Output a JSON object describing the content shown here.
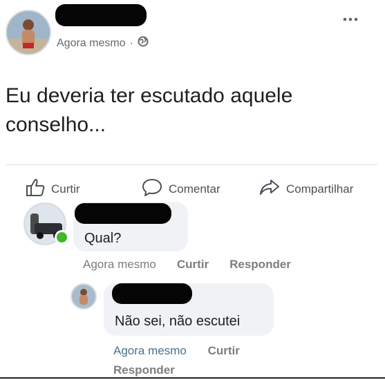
{
  "post": {
    "timestamp": "Agora mesmo",
    "separator": "·",
    "text": "Eu deveria ter escutado aquele conselho...",
    "menu_icon": "more-dots-icon",
    "privacy_icon": "globe-icon"
  },
  "actions": {
    "like": "Curtir",
    "comment": "Comentar",
    "share": "Compartilhar"
  },
  "comments": [
    {
      "text": "Qual?",
      "time": "Agora mesmo",
      "like": "Curtir",
      "reply": "Responder"
    },
    {
      "text": "Não sei, não escutei",
      "time": "Agora mesmo",
      "like": "Curtir",
      "reply": "Responder"
    }
  ]
}
